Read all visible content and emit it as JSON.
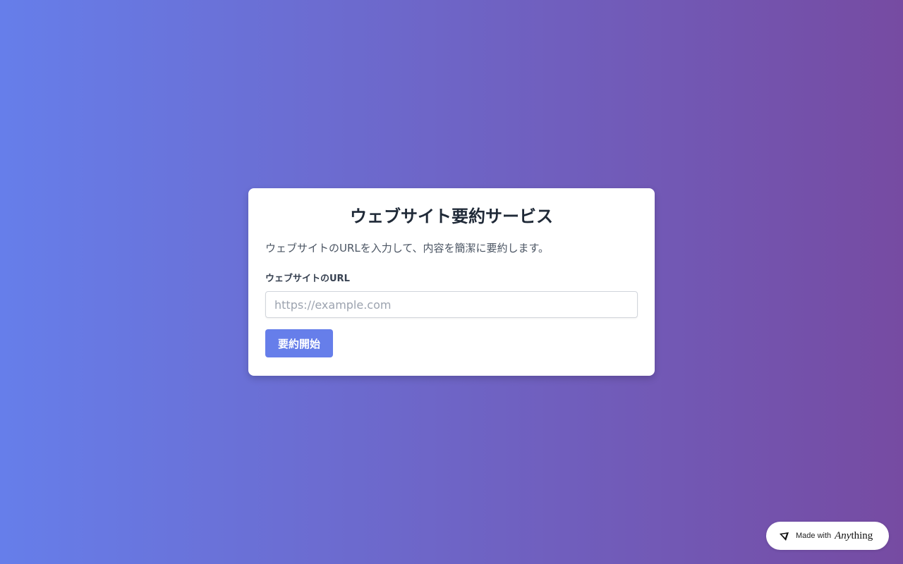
{
  "card": {
    "title": "ウェブサイト要約サービス",
    "description": "ウェブサイトのURLを入力して、内容を簡潔に要約します。",
    "url_label": "ウェブサイトのURL",
    "url_placeholder": "https://example.com",
    "url_value": "",
    "submit_label": "要約開始"
  },
  "badge": {
    "made_with": "Made with",
    "brand_italic": "Any",
    "brand_rest": "thing",
    "icon": "anything-logo-icon"
  },
  "colors": {
    "gradient_start": "#667eea",
    "gradient_end": "#764ba2",
    "button": "#667eea",
    "title_text": "#1f2937"
  }
}
